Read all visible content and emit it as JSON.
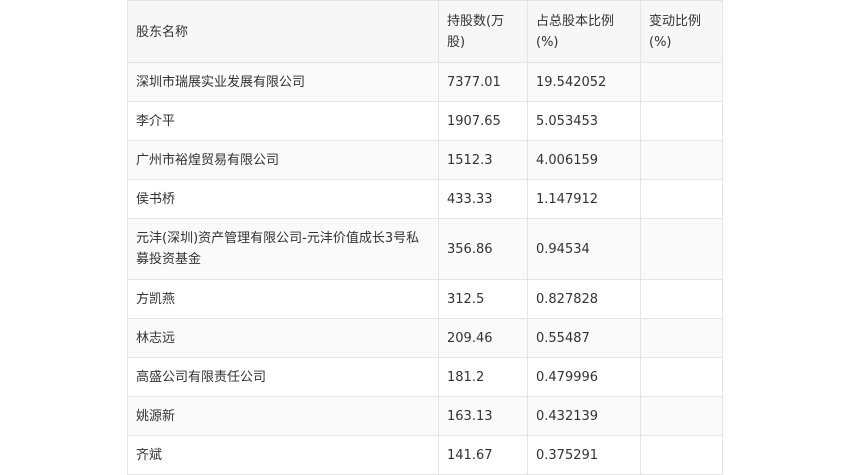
{
  "headers": [
    "股东名称",
    "持股数(万股)",
    "占总股本比例(%)",
    "变动比例(%)"
  ],
  "rows": [
    {
      "name": "深圳市瑞展实业发展有限公司",
      "shares": "7377.01",
      "ratio": "19.542052",
      "change": ""
    },
    {
      "name": "李介平",
      "shares": "1907.65",
      "ratio": "5.053453",
      "change": ""
    },
    {
      "name": "广州市裕煌贸易有限公司",
      "shares": "1512.3",
      "ratio": "4.006159",
      "change": ""
    },
    {
      "name": "侯书桥",
      "shares": "433.33",
      "ratio": "1.147912",
      "change": ""
    },
    {
      "name": "元沣(深圳)资产管理有限公司-元沣价值成长3号私募投资基金",
      "shares": "356.86",
      "ratio": "0.94534",
      "change": ""
    },
    {
      "name": "方凯燕",
      "shares": "312.5",
      "ratio": "0.827828",
      "change": ""
    },
    {
      "name": "林志远",
      "shares": "209.46",
      "ratio": "0.55487",
      "change": ""
    },
    {
      "name": "高盛公司有限责任公司",
      "shares": "181.2",
      "ratio": "0.479996",
      "change": ""
    },
    {
      "name": "姚源新",
      "shares": "163.13",
      "ratio": "0.432139",
      "change": ""
    },
    {
      "name": "齐斌",
      "shares": "141.67",
      "ratio": "0.375291",
      "change": ""
    }
  ]
}
